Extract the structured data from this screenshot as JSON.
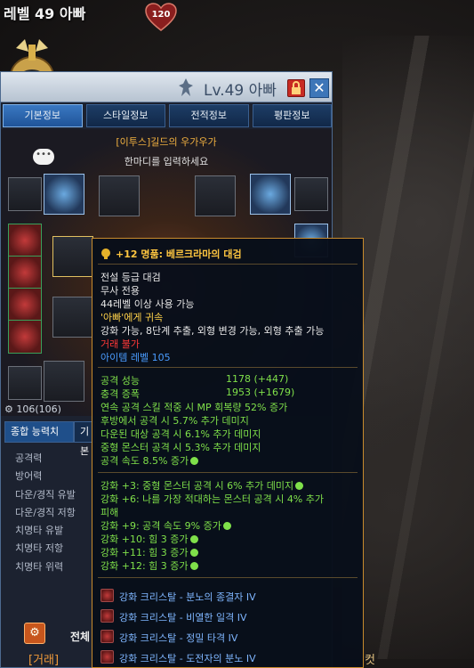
{
  "top": {
    "character_name": "레벨 49 아빠",
    "heart_value": "120"
  },
  "window": {
    "title": "Lv.49 아빠",
    "tabs": [
      "기본정보",
      "스타일정보",
      "전적정보",
      "평판정보"
    ],
    "guild": "[이투스]길드의 우가우가",
    "say_placeholder": "한마디를 입력하세요",
    "stats_summary_1": "106(106)",
    "subtabs": [
      "종합 능력치",
      "기본"
    ],
    "stats": [
      "공격력",
      "방어력",
      "다운/경직 유발",
      "다운/경직 저항",
      "치명타 유발",
      "치명타 저항",
      "치명타 위력"
    ],
    "bottom_label": "전체"
  },
  "chat": {
    "prefix": "[거래]",
    "tail": "컷"
  },
  "tooltip": {
    "title": "+12 명품: 베르크라마의 대검",
    "grade": "전설 등급 대검",
    "class": "무사 전용",
    "level_req": "44레벨 이상 사용 가능",
    "bound": "'아빠'에게 귀속",
    "options": "강화 가능, 8단계 추출, 외형 변경 가능, 외형 추출 가능",
    "trade": "거래 불가",
    "item_level": "아이템 레벨 105",
    "attack_label": "공격 성능",
    "attack_value": "1178 (+447)",
    "impact_label": "충격 증폭",
    "impact_value": "1953 (+1679)",
    "effects": [
      "연속 공격 스킬 적중 시 MP 회복량 52% 증가",
      "후방에서 공격 시 5.7% 추가 데미지",
      "다운된 대상 공격 시 6.1% 추가 데미지",
      "중형 몬스터 공격 시 5.3% 추가 데미지",
      "공격 속도 8.5% 증가"
    ],
    "enhancements": [
      "강화 +3: 중형 몬스터 공격 시 6% 추가 데미지",
      "강화 +6: 나를 가장 적대하는 몬스터 공격 시 4% 추가",
      "피해",
      "강화 +9: 공격 속도 9% 증가",
      "강화 +10: 힘 3 증가",
      "강화 +11: 힘 3 증가",
      "강화 +12: 힘 3 증가"
    ],
    "crystals": [
      "강화 크리스탈 - 분노의 종결자 IV",
      "강화 크리스탈 - 비열한 일격 IV",
      "강화 크리스탈 - 정밀 타격 IV",
      "강화 크리스탈 - 도전자의 분노 IV"
    ]
  }
}
